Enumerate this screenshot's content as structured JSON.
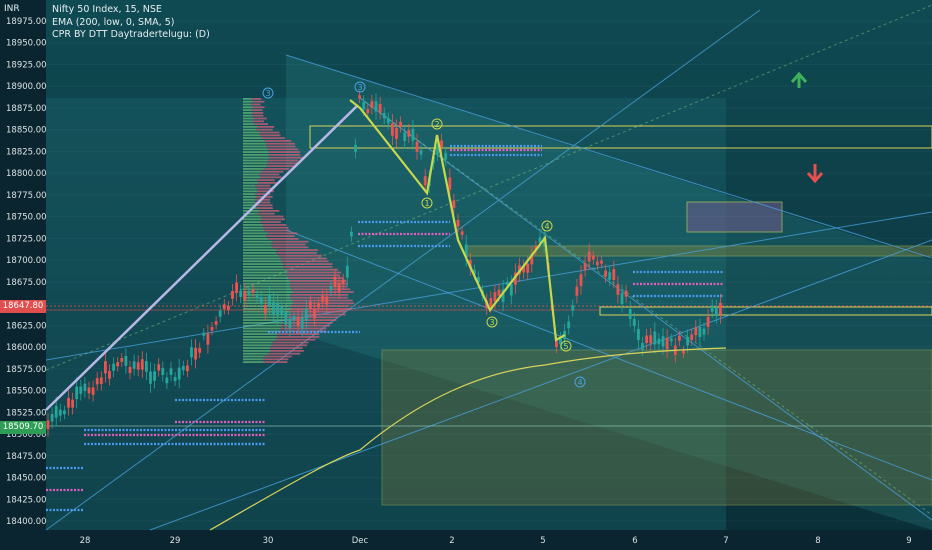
{
  "header": {
    "currency": "INR",
    "legend": [
      "Nifty 50 Index, 15, NSE",
      "EMA (200, low, 0, SMA, 5)",
      "CPR BY DTT Daytradertelugu: (D)"
    ]
  },
  "chart_data": {
    "type": "candlestick",
    "symbol": "Nifty 50 Index",
    "interval": "15",
    "exchange": "NSE",
    "y_ticks": [
      "18975.00",
      "18950.00",
      "18925.00",
      "18900.00",
      "18875.00",
      "18850.00",
      "18825.00",
      "18800.00",
      "18775.00",
      "18750.00",
      "18725.00",
      "18700.00",
      "18675.00",
      "18650.00",
      "18625.00",
      "18600.00",
      "18575.00",
      "18550.00",
      "18525.00",
      "18500.00",
      "18475.00",
      "18450.00",
      "18425.00",
      "18400.00"
    ],
    "x_ticks": [
      "28",
      "29",
      "30",
      "Dec",
      "2",
      "5",
      "6",
      "7",
      "8",
      "9"
    ],
    "ylim": [
      18390,
      18985
    ],
    "last_price": "18647.80",
    "marked_price": "18509.70",
    "elliott_wave_labels": [
      "1",
      "2",
      "3",
      "4",
      "5"
    ],
    "secondary_wave_labels": [
      "3",
      "4"
    ],
    "ema_line": "EMA 200",
    "arrows": [
      "up",
      "down"
    ],
    "colors": {
      "bull": "#26a69a",
      "bear": "#ef5350",
      "wave": "#c8d84a",
      "ema": "#d8d35a",
      "channel": "#4aa3e0",
      "last_price_bg": "#e04e4e",
      "marked_price_bg": "#2e9e56",
      "up_arrow": "#3fb15a",
      "down_arrow": "#e85050"
    }
  }
}
